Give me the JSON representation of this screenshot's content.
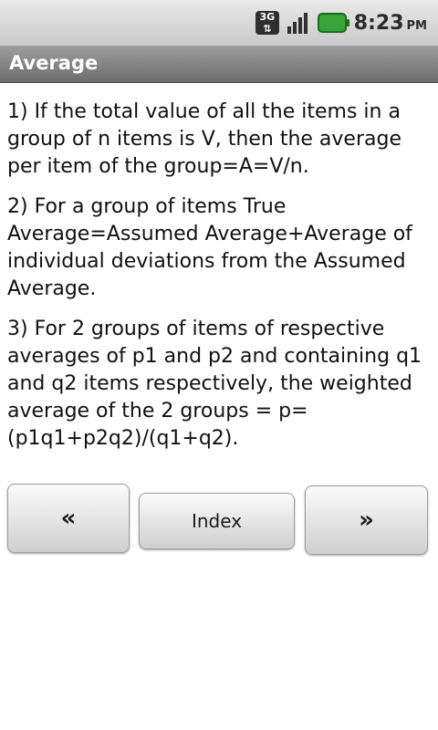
{
  "status_bar": {
    "network_label": "3G",
    "time": "8:23",
    "ampm": "PM",
    "icons": [
      "3g-network-icon",
      "signal-strength-icon",
      "battery-icon"
    ]
  },
  "title_bar": {
    "title": "Average"
  },
  "content": {
    "paragraphs": [
      "1) If the total value of all the items in a group of n items is V, then the average per item of the group=A=V/n.",
      "2) For a group of items True Average=Assumed Average+Average of individual deviations from the Assumed Average.",
      "3) For 2 groups of items of respective averages of p1 and p2 and containing q1 and q2 items respectively, the weighted average of the 2 groups = p=(p1q1+p2q2)/(q1+q2)."
    ]
  },
  "navigation": {
    "prev_label": "«",
    "index_label": "Index",
    "next_label": "»"
  }
}
